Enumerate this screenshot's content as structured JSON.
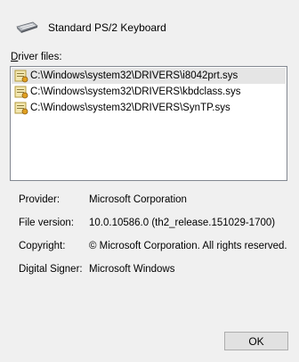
{
  "header": {
    "device_name": "Standard PS/2 Keyboard",
    "icon": "keyboard-icon"
  },
  "driver_files": {
    "label": "Driver files:",
    "accel_key": "D",
    "items": [
      {
        "path": "C:\\Windows\\system32\\DRIVERS\\i8042prt.sys",
        "icon": "driver-file-icon",
        "selected": true
      },
      {
        "path": "C:\\Windows\\system32\\DRIVERS\\kbdclass.sys",
        "icon": "driver-file-icon",
        "selected": false
      },
      {
        "path": "C:\\Windows\\system32\\DRIVERS\\SynTP.sys",
        "icon": "driver-file-icon",
        "selected": false
      }
    ]
  },
  "properties": {
    "provider_label": "Provider:",
    "provider_value": "Microsoft Corporation",
    "version_label": "File version:",
    "version_value": "10.0.10586.0 (th2_release.151029-1700)",
    "copyright_label": "Copyright:",
    "copyright_value": "© Microsoft Corporation. All rights reserved.",
    "signer_label": "Digital Signer:",
    "signer_value": "Microsoft Windows"
  },
  "buttons": {
    "ok_label": "OK"
  },
  "colors": {
    "background": "#f0f0f0",
    "selection": "#e5e5e5",
    "list_border": "#828790"
  }
}
